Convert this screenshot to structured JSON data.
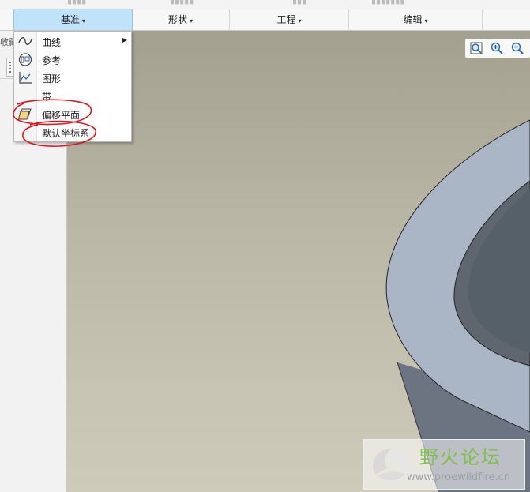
{
  "ribbon": {
    "groups": [
      {
        "label": "基准",
        "active": true
      },
      {
        "label": "形状",
        "active": false
      },
      {
        "label": "工程",
        "active": false
      },
      {
        "label": "编辑",
        "active": false
      }
    ],
    "caret": "▾"
  },
  "left_panel": {
    "tab_label": "收藏"
  },
  "datum_menu": {
    "items": [
      {
        "label": "曲线",
        "icon": "curve-icon",
        "has_submenu": true
      },
      {
        "label": "参考",
        "icon": "reference-icon",
        "has_submenu": false
      },
      {
        "label": "图形",
        "icon": "graph-icon",
        "has_submenu": false
      },
      {
        "label": "带",
        "icon": "ribbon-icon",
        "has_submenu": false
      },
      {
        "label": "偏移平面",
        "icon": "offset-plane-icon",
        "has_submenu": false
      },
      {
        "label": "默认坐标系",
        "icon": "",
        "has_submenu": false
      }
    ],
    "submenu_arrow": "▶"
  },
  "view_toolbar": {
    "tools": [
      "refit-zoom-icon",
      "zoom-in-icon",
      "zoom-out-icon"
    ]
  },
  "watermark": {
    "title": "野火论坛",
    "url": "www.proewildfire.cn"
  },
  "colors": {
    "active_tab": "#bfe3fb",
    "model_face": "#aab6c6",
    "model_inner": "#5f6670",
    "annotation": "#e0141e",
    "watermark_green": "#7fc04d"
  }
}
